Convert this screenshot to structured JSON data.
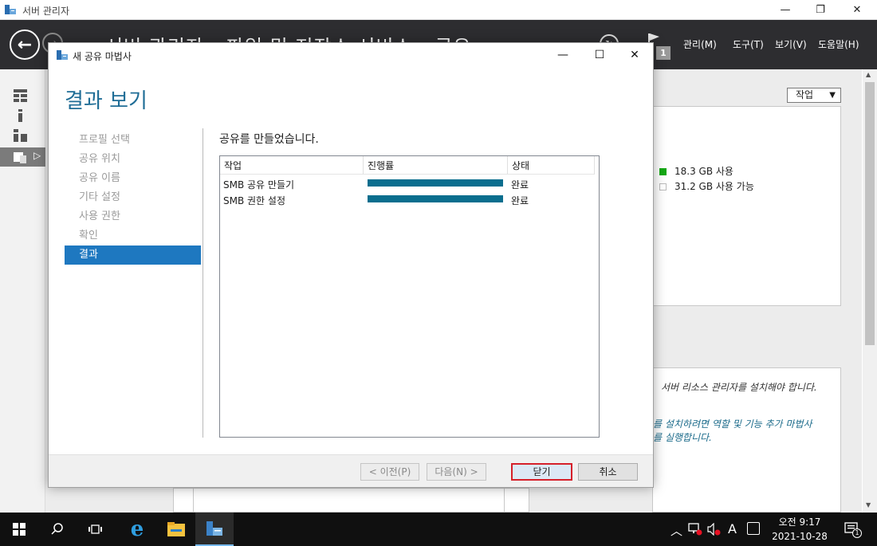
{
  "outer_window": {
    "title": "서버 관리자",
    "min": "—",
    "restore": "❐",
    "close": "✕"
  },
  "header": {
    "breadcrumb": "서버 관리자 › 파일 및 저장소 서비스 › 공유",
    "notification_count": "1",
    "menus": [
      "관리(M)",
      "도구(T)",
      "보기(V)",
      "도움말(H)"
    ]
  },
  "background": {
    "task_button": "작업",
    "legend": [
      {
        "label": "18.3 GB 사용",
        "color": "#13a813"
      },
      {
        "label": "31.2 GB 사용 가능",
        "color": "#ffffff"
      }
    ],
    "info_line1": "서버 리소스 관리자를 설치해야 합니다.",
    "info_line2": "를 설치하려면 역할 및 기능 추가 마법사",
    "info_line3": "를 실행합니다."
  },
  "wizard": {
    "title": "새 공유 마법사",
    "heading": "결과 보기",
    "steps": [
      "프로필 선택",
      "공유 위치",
      "공유 이름",
      "기타 설정",
      "사용 권한",
      "확인",
      "결과"
    ],
    "active_step": 6,
    "result_message": "공유를 만들었습니다.",
    "columns": [
      "작업",
      "진행률",
      "상태"
    ],
    "rows": [
      {
        "task": "SMB 공유 만들기",
        "progress": 1.0,
        "status": "완료"
      },
      {
        "task": "SMB 권한 설정",
        "progress": 1.0,
        "status": "완료"
      }
    ],
    "buttons": {
      "prev": "< 이전(P)",
      "next": "다음(N) >",
      "close": "닫기",
      "cancel": "취소"
    }
  },
  "taskbar": {
    "tray_lang": "A",
    "time": "오전 9:17",
    "date": "2021-10-28",
    "notification_count": "1"
  }
}
